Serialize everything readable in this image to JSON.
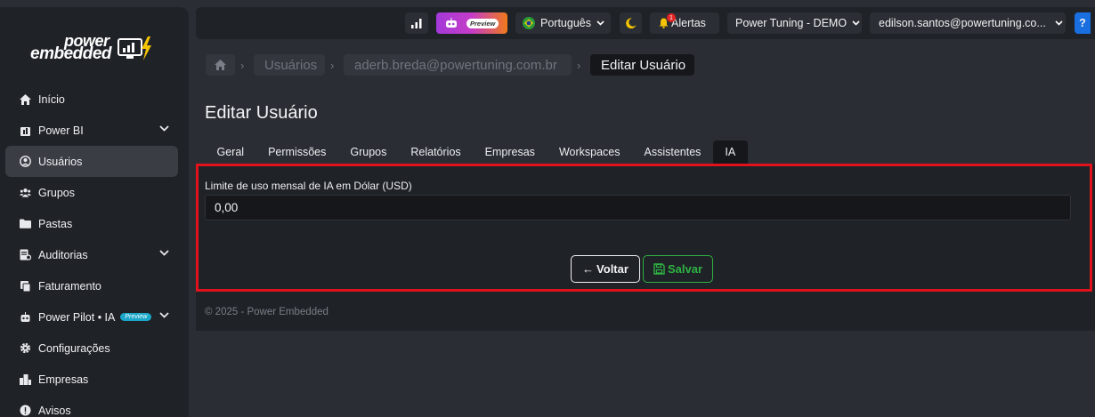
{
  "logo": {
    "line1": "power",
    "line2": "embedded"
  },
  "sidebar": {
    "items": [
      {
        "label": "Início",
        "icon": "home-icon"
      },
      {
        "label": "Power BI",
        "icon": "powerbi-icon",
        "expandable": true
      },
      {
        "label": "Usuários",
        "icon": "user-circle-icon",
        "active": true
      },
      {
        "label": "Grupos",
        "icon": "users-icon"
      },
      {
        "label": "Pastas",
        "icon": "folder-icon"
      },
      {
        "label": "Auditorias",
        "icon": "audit-icon",
        "expandable": true
      },
      {
        "label": "Faturamento",
        "icon": "billing-icon"
      },
      {
        "label": "Power Pilot • IA",
        "icon": "robot-icon",
        "badge": "Preview",
        "expandable": true
      },
      {
        "label": "Configurações",
        "icon": "gear-icon"
      },
      {
        "label": "Empresas",
        "icon": "building-icon"
      },
      {
        "label": "Avisos",
        "icon": "notice-icon"
      }
    ]
  },
  "topbar": {
    "ai_badge": "Preview",
    "language": "Português",
    "alerts_label": "Alertas",
    "alerts_count": "1",
    "org": "Power Tuning - DEMO",
    "user": "edilson.santos@powertuning.co...",
    "help": "?"
  },
  "breadcrumb": {
    "users": "Usuários",
    "email": "aderb.breda@powertuning.com.br",
    "current": "Editar Usuário"
  },
  "page_title": "Editar Usuário",
  "tabs": [
    "Geral",
    "Permissões",
    "Grupos",
    "Relatórios",
    "Empresas",
    "Workspaces",
    "Assistentes",
    "IA"
  ],
  "active_tab": "IA",
  "form": {
    "limit_label": "Limite de uso mensal de IA em Dólar (USD)",
    "limit_value": "0,00"
  },
  "buttons": {
    "back": "Voltar",
    "save": "Salvar"
  },
  "footer": "© 2025 - Power Embedded",
  "colors": {
    "highlight": "#e0121c",
    "save": "#2fb344",
    "help": "#1a6fe0"
  }
}
